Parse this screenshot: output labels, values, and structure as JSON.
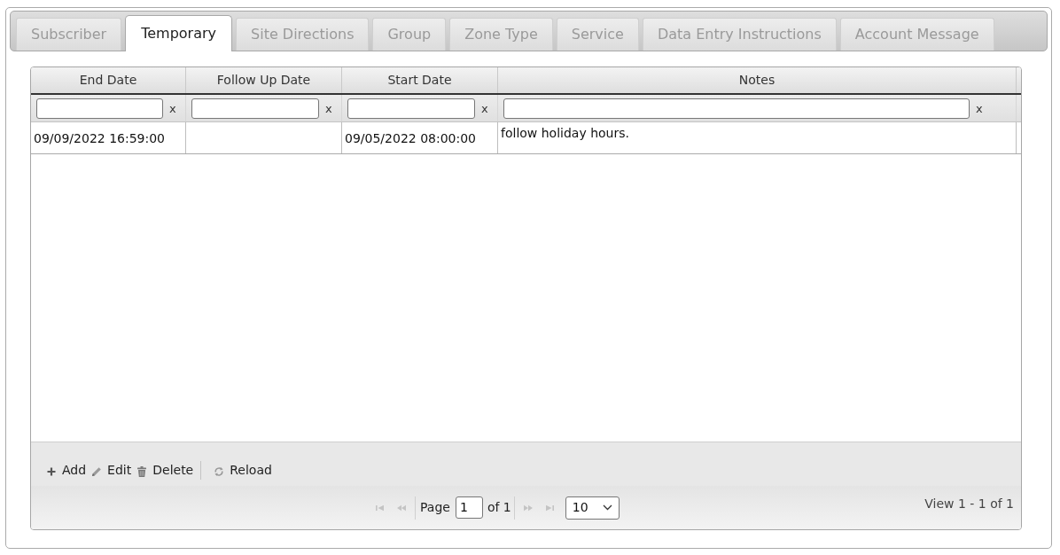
{
  "tabs": [
    {
      "label": "Subscriber",
      "selected": false
    },
    {
      "label": "Temporary",
      "selected": true
    },
    {
      "label": "Site Directions",
      "selected": false
    },
    {
      "label": "Group",
      "selected": false
    },
    {
      "label": "Zone Type",
      "selected": false
    },
    {
      "label": "Service",
      "selected": false
    },
    {
      "label": "Data Entry Instructions",
      "selected": false
    },
    {
      "label": "Account Message",
      "selected": false
    }
  ],
  "grid": {
    "columns": [
      {
        "label": "End Date",
        "clear_filter": "x"
      },
      {
        "label": "Follow Up Date",
        "clear_filter": "x"
      },
      {
        "label": "Start Date",
        "clear_filter": "x"
      },
      {
        "label": "Notes",
        "clear_filter": "x"
      }
    ],
    "rows": [
      {
        "cells": [
          "09/09/2022 16:59:00",
          null,
          "09/05/2022 08:00:00",
          "follow holiday hours."
        ]
      }
    ],
    "toolbar": [
      {
        "kind": "add",
        "label": "Add",
        "separator_before": false
      },
      {
        "kind": "edit",
        "label": "Edit",
        "separator_before": false
      },
      {
        "kind": "delete",
        "label": "Delete",
        "separator_before": false
      },
      {
        "kind": "reload",
        "label": "Reload",
        "separator_before": true
      }
    ],
    "pager": {
      "nav": [
        {
          "kind": "first",
          "disabled": true
        },
        {
          "kind": "prev",
          "disabled": true
        },
        {
          "kind": "next",
          "disabled": true
        },
        {
          "kind": "last",
          "disabled": true
        }
      ],
      "page_label": "Page",
      "page": "1",
      "page_count": "of 1",
      "page_size": "10",
      "view_info": "View 1 - 1 of 1"
    }
  }
}
